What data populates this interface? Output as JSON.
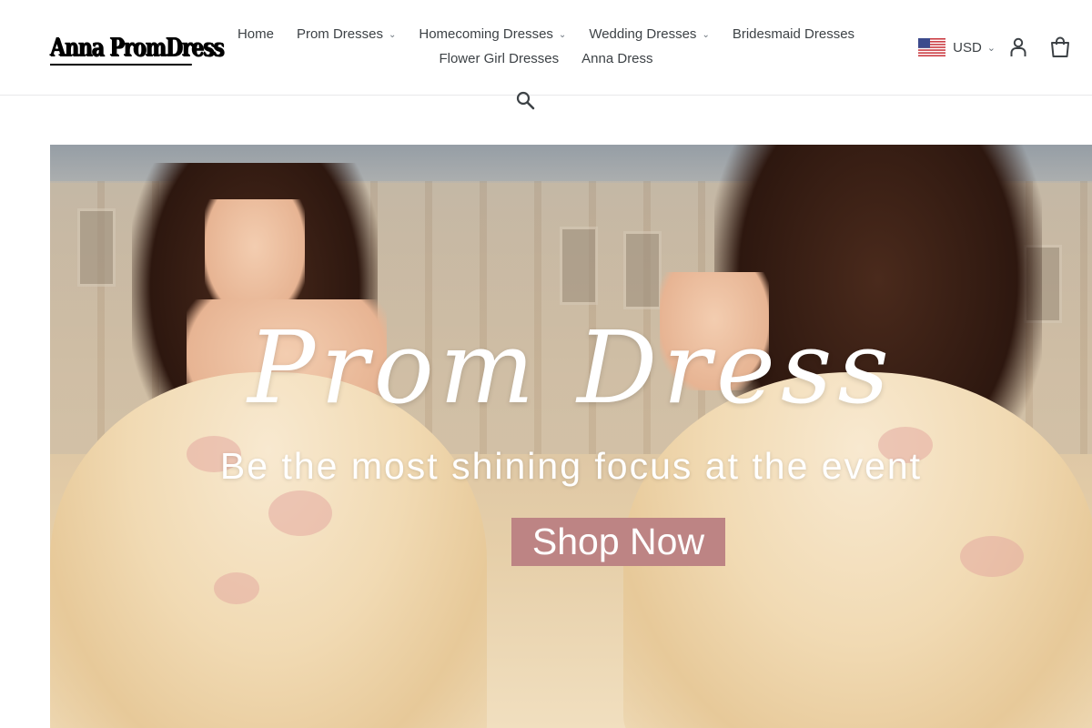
{
  "brand": {
    "logo_text": "Anna PromDress"
  },
  "nav": {
    "row1": [
      {
        "label": "Home",
        "dropdown": false
      },
      {
        "label": "Prom Dresses",
        "dropdown": true
      },
      {
        "label": "Homecoming Dresses",
        "dropdown": true
      },
      {
        "label": "Wedding Dresses",
        "dropdown": true
      },
      {
        "label": "Bridesmaid Dresses",
        "dropdown": false
      }
    ],
    "row2": [
      {
        "label": "Flower Girl Dresses",
        "dropdown": false
      },
      {
        "label": "Anna Dress",
        "dropdown": false
      }
    ]
  },
  "currency": {
    "code": "USD",
    "flag": "us-flag-icon"
  },
  "icons": {
    "account": "user-icon",
    "cart": "cart-icon",
    "search": "search-icon"
  },
  "hero": {
    "title": "Prom Dress",
    "subtitle": "Be the most shining focus at the event",
    "cta_label": "Shop Now",
    "cta_color": "#bd8484"
  }
}
